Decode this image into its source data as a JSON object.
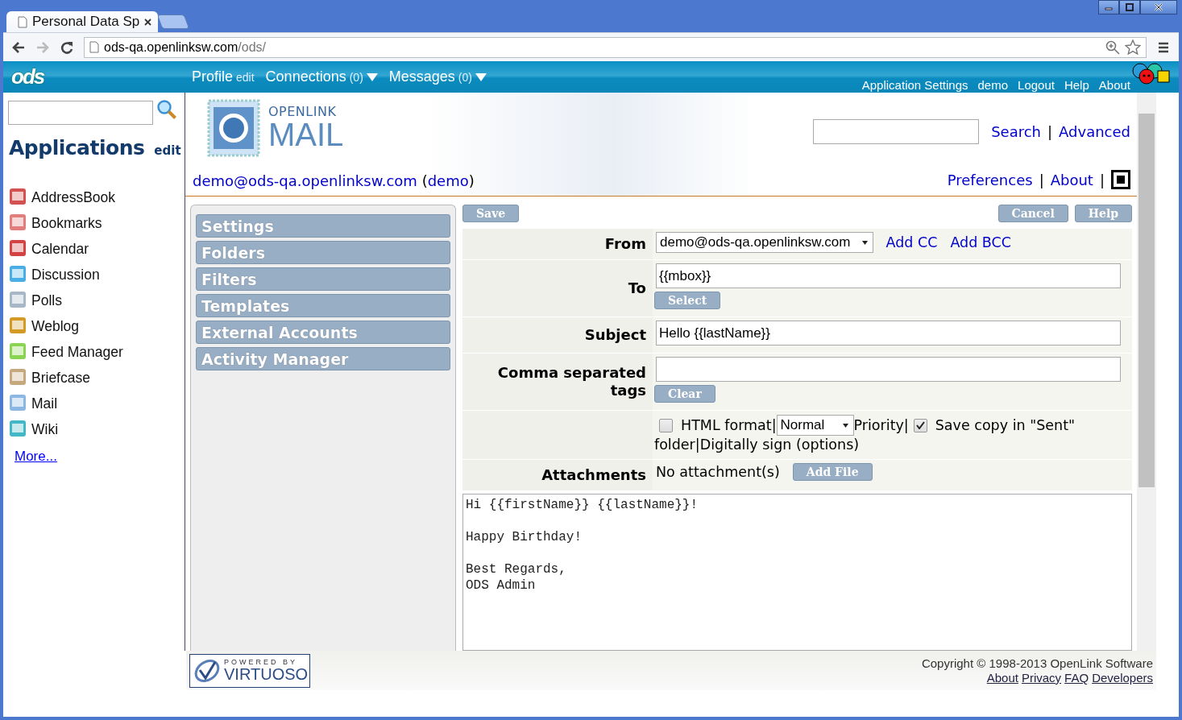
{
  "window": {
    "tab_title": "Personal Data Sp",
    "url_host": "ods-qa.openlinksw.com",
    "url_path": "/ods/"
  },
  "topbar": {
    "logo": "ods",
    "nav": [
      {
        "label": "Profile",
        "suffix": "edit",
        "dropdown": false
      },
      {
        "label": "Connections",
        "suffix": "(0)",
        "dropdown": true
      },
      {
        "label": "Messages",
        "suffix": "(0)",
        "dropdown": true
      }
    ],
    "links": [
      "Application Settings",
      "demo",
      "Logout",
      "Help",
      "About"
    ]
  },
  "sidebar": {
    "heading": "Applications",
    "heading_action": "edit",
    "apps": [
      "AddressBook",
      "Bookmarks",
      "Calendar",
      "Discussion",
      "Polls",
      "Weblog",
      "Feed Manager",
      "Briefcase",
      "Mail",
      "Wiki"
    ],
    "more": "More..."
  },
  "mail": {
    "logo_top": "OPENLINK",
    "logo_main": "MAIL",
    "separator": "|",
    "search_links": [
      "Search",
      "Advanced"
    ],
    "account": {
      "email": "demo@ods-qa.openlinksw.com",
      "open": "(",
      "name": "demo",
      "close": ")"
    },
    "header_links": [
      "Preferences",
      "About"
    ],
    "menu": [
      "Settings",
      "Folders",
      "Filters",
      "Templates",
      "External Accounts",
      "Activity Manager"
    ],
    "compose": {
      "buttons_left": [
        "Save"
      ],
      "buttons_right": [
        "Cancel",
        "Help"
      ],
      "from": {
        "label": "From",
        "value": "demo@ods-qa.openlinksw.com",
        "links": [
          "Add CC",
          "Add BCC"
        ]
      },
      "to": {
        "label": "To",
        "value": "{{mbox}}",
        "button": "Select"
      },
      "subject": {
        "label": "Subject",
        "value": "Hello {{lastName}}"
      },
      "tags": {
        "label": "Comma separated tags",
        "button": "Clear"
      },
      "options": {
        "html_format": {
          "label": "HTML format",
          "checked": false
        },
        "priority": {
          "value": "Normal",
          "label": "Priority"
        },
        "save_copy": {
          "label": "Save copy in \"Sent\"",
          "label_continued": "folder",
          "checked": true
        },
        "sign": "Digitally sign (options)"
      },
      "attachments": {
        "label": "Attachments",
        "value": "No attachment(s)",
        "button": "Add File"
      },
      "body": "Hi {{firstName}} {{lastName}}!\n\nHappy Birthday!\n\nBest Regards,\nODS Admin"
    }
  },
  "footer": {
    "powered_by": "POWERED BY",
    "product": "VIRTUOSO",
    "copyright": "Copyright © 1998-2013 OpenLink Software",
    "links": [
      "About",
      "Privacy",
      "FAQ",
      "Developers"
    ]
  }
}
